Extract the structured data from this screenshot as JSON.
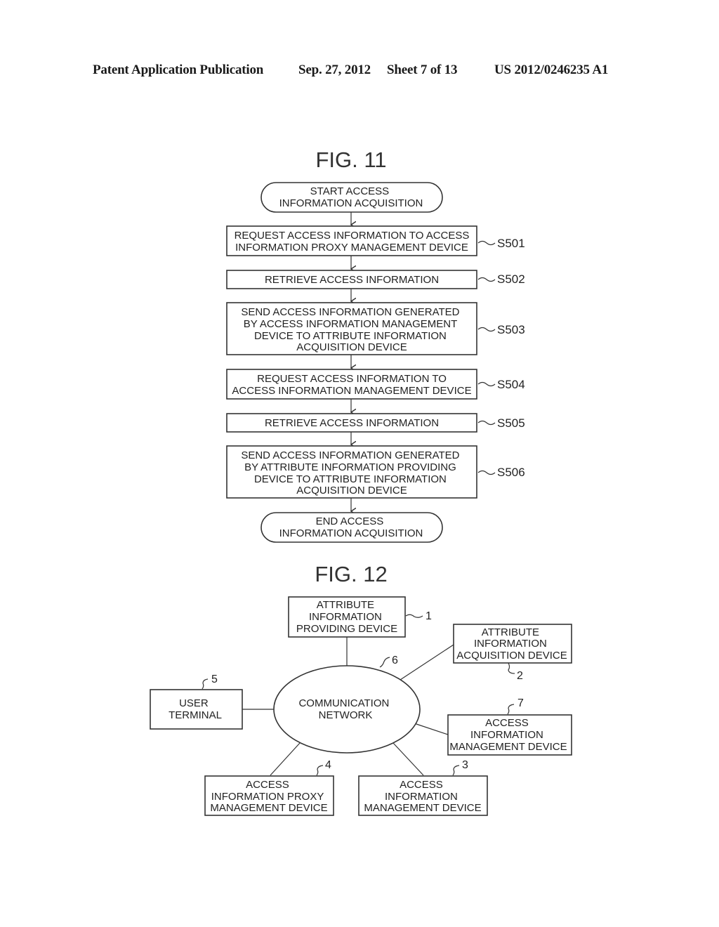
{
  "header": {
    "publication": "Patent Application Publication",
    "date": "Sep. 27, 2012",
    "sheet": "Sheet 7 of 13",
    "number": "US 2012/0246235 A1"
  },
  "fig11": {
    "title": "FIG. 11",
    "start": [
      "START ACCESS",
      "INFORMATION ACQUISITION"
    ],
    "steps": [
      {
        "id": "S501",
        "lines": [
          "REQUEST ACCESS INFORMATION TO ACCESS",
          "INFORMATION PROXY MANAGEMENT DEVICE"
        ]
      },
      {
        "id": "S502",
        "lines": [
          "RETRIEVE ACCESS INFORMATION"
        ]
      },
      {
        "id": "S503",
        "lines": [
          "SEND ACCESS INFORMATION GENERATED",
          "BY ACCESS INFORMATION MANAGEMENT",
          "DEVICE TO ATTRIBUTE INFORMATION",
          "ACQUISITION DEVICE"
        ]
      },
      {
        "id": "S504",
        "lines": [
          "REQUEST ACCESS INFORMATION TO",
          "ACCESS INFORMATION MANAGEMENT DEVICE"
        ]
      },
      {
        "id": "S505",
        "lines": [
          "RETRIEVE ACCESS INFORMATION"
        ]
      },
      {
        "id": "S506",
        "lines": [
          "SEND ACCESS INFORMATION GENERATED",
          "BY ATTRIBUTE INFORMATION PROVIDING",
          "DEVICE TO ATTRIBUTE INFORMATION",
          "ACQUISITION DEVICE"
        ]
      }
    ],
    "end": [
      "END ACCESS",
      "INFORMATION ACQUISITION"
    ]
  },
  "fig12": {
    "title": "FIG. 12",
    "network": {
      "ref": "6",
      "lines": [
        "COMMUNICATION",
        "NETWORK"
      ]
    },
    "devices": [
      {
        "ref": "1",
        "lines": [
          "ATTRIBUTE",
          "INFORMATION",
          "PROVIDING DEVICE"
        ]
      },
      {
        "ref": "2",
        "lines": [
          "ATTRIBUTE",
          "INFORMATION",
          "ACQUISITION DEVICE"
        ]
      },
      {
        "ref": "3",
        "lines": [
          "ACCESS",
          "INFORMATION",
          "MANAGEMENT  DEVICE"
        ]
      },
      {
        "ref": "4",
        "lines": [
          "ACCESS",
          "INFORMATION PROXY",
          "MANAGEMENT  DEVICE"
        ]
      },
      {
        "ref": "5",
        "lines": [
          "USER",
          "TERMINAL"
        ]
      },
      {
        "ref": "7",
        "lines": [
          "ACCESS",
          "INFORMATION",
          "MANAGEMENT DEVICE"
        ]
      }
    ]
  }
}
